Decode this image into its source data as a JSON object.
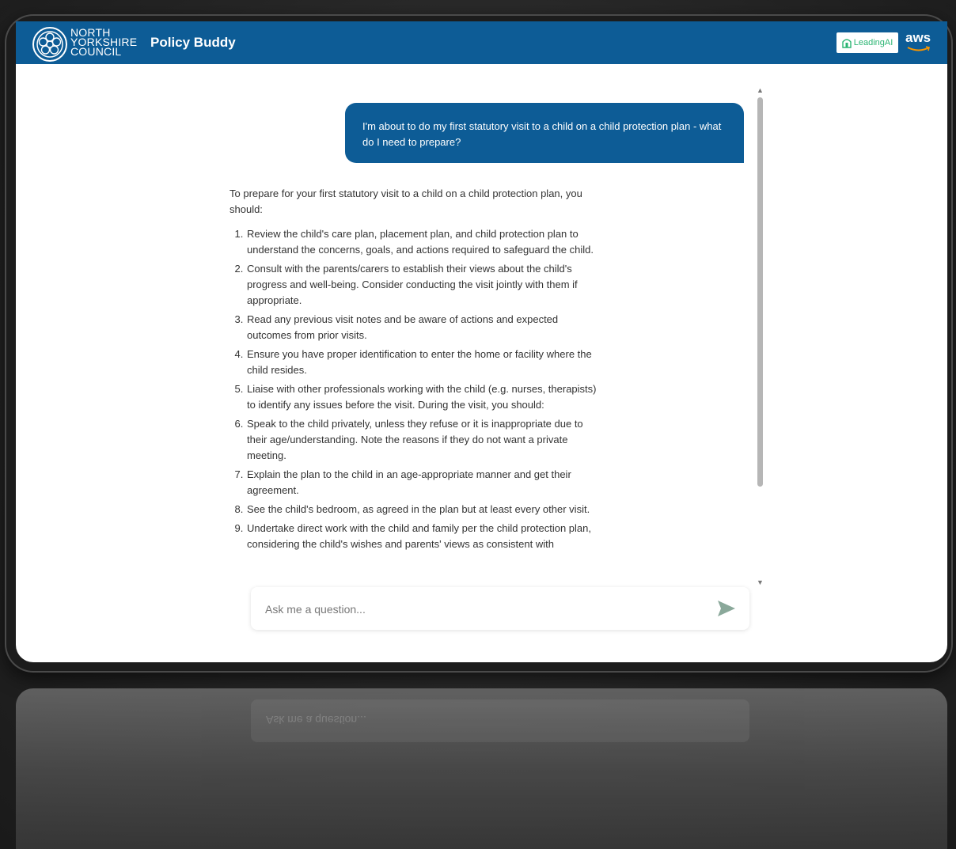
{
  "header": {
    "org_line1": "NORTH",
    "org_line2": "YORKSHIRE",
    "org_line3": "COUNCIL",
    "app_title": "Policy Buddy",
    "partner1": "LeadingAI",
    "partner2": "aws"
  },
  "conversation": {
    "user_message": "I'm about to do my first statutory visit to a child on a child protection plan - what do I need to prepare?",
    "answer_intro": "To prepare for your first statutory visit to a child on a child protection plan, you should:",
    "answer_items": [
      "Review the child's care plan, placement plan, and child protection plan to understand the concerns, goals, and actions required to safeguard the child.",
      "Consult with the parents/carers to establish their views about the child's progress and well-being. Consider conducting the visit jointly with them if appropriate.",
      "Read any previous visit notes and be aware of actions and expected outcomes from prior visits.",
      "Ensure you have proper identification to enter the home or facility where the child resides.",
      "Liaise with other professionals working with the child (e.g. nurses, therapists) to identify any issues before the visit. During the visit, you should:",
      "Speak to the child privately, unless they refuse or it is inappropriate due to their age/understanding. Note the reasons if they do not want a private meeting.",
      "Explain the plan to the child in an age-appropriate manner and get their agreement.",
      "See the child's bedroom, as agreed in the plan but at least every other visit.",
      "Undertake direct work with the child and family per the child protection plan, considering the child's wishes and parents' views as consistent with"
    ]
  },
  "input": {
    "placeholder": "Ask me a question..."
  },
  "colors": {
    "brand": "#0d5c96",
    "send_icon": "#8aa89a",
    "leadingai_green": "#2bb573"
  }
}
